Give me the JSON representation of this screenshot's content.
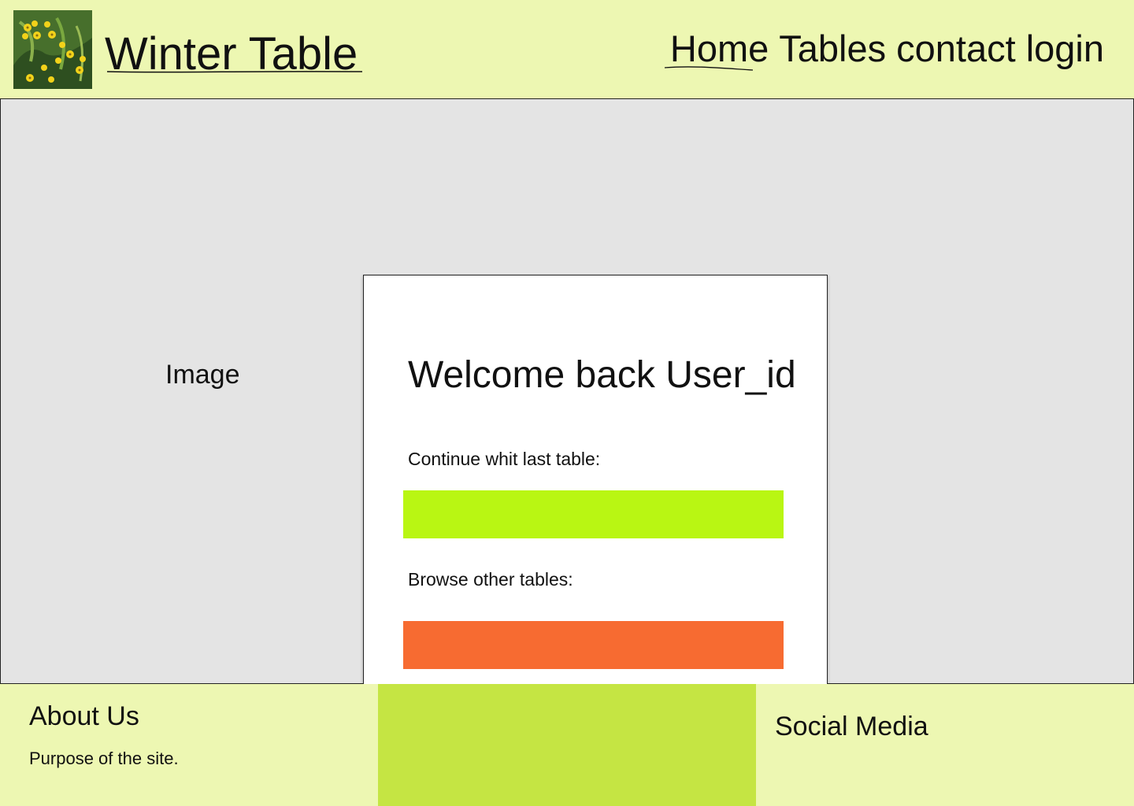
{
  "header": {
    "site_title": "Winter Table",
    "nav": [
      "Home",
      "Tables",
      "contact",
      "login"
    ]
  },
  "main": {
    "image_placeholder": "Image",
    "card": {
      "heading": "Welcome back User_id",
      "continue_label": "Continue whit last table:",
      "browse_label": "Browse other tables:"
    }
  },
  "footer": {
    "about_heading": "About Us",
    "about_text": "Purpose of the site.",
    "social_heading": "Social Media"
  },
  "colors": {
    "header_bg": "#edf7b2",
    "main_bg": "#e4e4e4",
    "continue_button": "#b9f613",
    "browse_button": "#f76b31",
    "footer_middle": "#c5e543"
  }
}
